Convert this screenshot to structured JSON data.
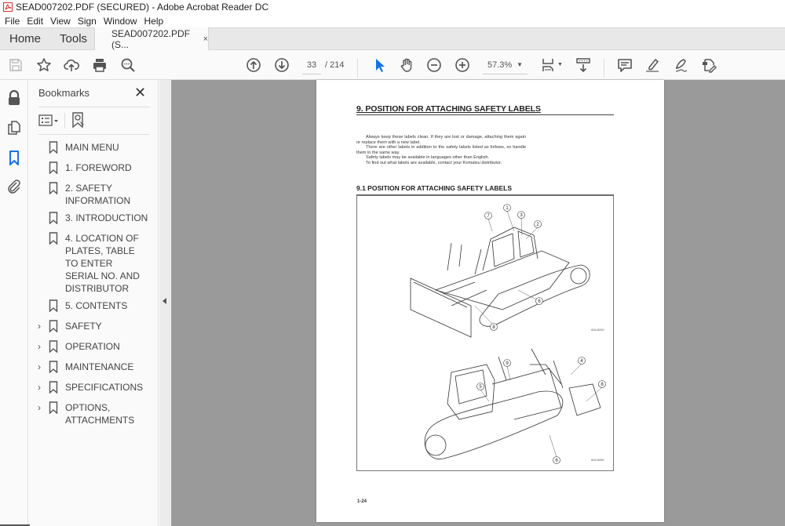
{
  "window": {
    "title": "SEAD007202.PDF (SECURED) - Adobe Acrobat Reader DC",
    "app_icon": "acrobat-pdf-icon"
  },
  "menu": [
    "File",
    "Edit",
    "View",
    "Sign",
    "Window",
    "Help"
  ],
  "tabs": {
    "home": "Home",
    "tools": "Tools",
    "document": "SEAD007202.PDF (S...",
    "close": "×"
  },
  "toolbar": {
    "left_icons": [
      "save-icon",
      "bookmark-star-icon",
      "upload-cloud-icon",
      "print-icon",
      "find-icon"
    ],
    "nav_icons": [
      "page-up-icon",
      "page-down-icon"
    ],
    "current_page": "33",
    "total_pages": "/ 214",
    "tools": [
      "select-cursor-icon",
      "hand-icon",
      "zoom-out-icon",
      "zoom-in-icon"
    ],
    "zoom_level": "57.3%",
    "view_icons": [
      "page-fit-icon",
      "scroll-mode-icon"
    ],
    "annot_icons": [
      "comment-icon",
      "highlight-icon",
      "sign-icon",
      "fill-sign-icon"
    ],
    "accent_color": "#1473e6"
  },
  "navrail": [
    "lock-icon",
    "pages-icon",
    "bookmarks-icon",
    "attachment-icon"
  ],
  "bookmarks": {
    "title": "Bookmarks",
    "close": "✕",
    "items": [
      {
        "label": "MAIN MENU",
        "expandable": false
      },
      {
        "label": "1. FOREWORD",
        "expandable": false
      },
      {
        "label": "2. SAFETY INFORMATION",
        "expandable": false
      },
      {
        "label": "3. INTRODUCTION",
        "expandable": false
      },
      {
        "label": "4. LOCATION OF PLATES, TABLE TO ENTER SERIAL NO. AND DISTRIBUTOR",
        "expandable": false
      },
      {
        "label": "5. CONTENTS",
        "expandable": false
      },
      {
        "label": "SAFETY",
        "expandable": true
      },
      {
        "label": "OPERATION",
        "expandable": true
      },
      {
        "label": "MAINTENANCE",
        "expandable": true
      },
      {
        "label": "SPECIFICATIONS",
        "expandable": true
      },
      {
        "label": "OPTIONS, ATTACHMENTS",
        "expandable": true
      }
    ]
  },
  "page": {
    "heading": "9. POSITION FOR ATTACHING SAFETY LABELS",
    "paragraphs": [
      "Always keep these labels clean. If they are lost or damage, attaching them again or replace them with a new label.",
      "There are other labels in addition to the safety labels listed as follows, so handle them in the same way.",
      "Safety labels may be available in languages other than English.",
      "To find out what labels are available, contact your Komatsu distributor."
    ],
    "subheading": "9.1 POSITION FOR ATTACHING SAFETY LABELS",
    "figure_top_callouts": [
      "1",
      "7",
      "3",
      "2",
      "6",
      "8"
    ],
    "figure_top_code": "AN146240",
    "figure_bottom_callouts": [
      "9",
      "4",
      "5",
      "8",
      "6"
    ],
    "figure_bottom_code": "AN146250",
    "page_number": "1-24"
  }
}
